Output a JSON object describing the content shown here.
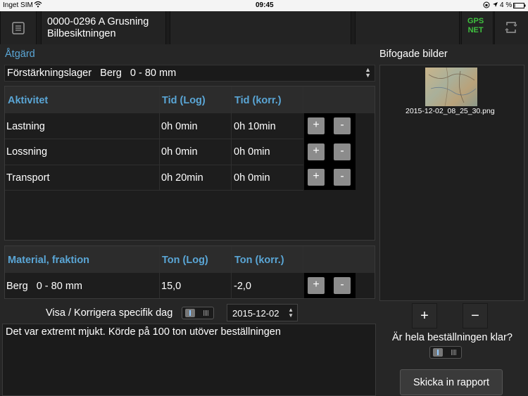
{
  "status_bar": {
    "carrier": "Inget SIM",
    "time": "09:45",
    "battery": "4 %"
  },
  "header": {
    "order_line1": "0000-0296 A Grusning",
    "order_line2": "Bilbesiktningen",
    "gps_line1": "GPS",
    "gps_line2": "NET"
  },
  "atgard": {
    "label": "Åtgärd",
    "selected": "Förstärkningslager   Berg   0 - 80 mm"
  },
  "activity_table": {
    "headers": [
      "Aktivitet",
      "Tid (Log)",
      "Tid (korr.)"
    ],
    "rows": [
      {
        "name": "Lastning",
        "log": "0h 0min",
        "korr": "0h 10min"
      },
      {
        "name": "Lossning",
        "log": "0h 0min",
        "korr": "0h 0min"
      },
      {
        "name": "Transport",
        "log": "0h 20min",
        "korr": "0h 0min"
      }
    ],
    "plus": "+",
    "minus": "-"
  },
  "material_table": {
    "headers": [
      "Material, fraktion",
      "Ton (Log)",
      "Ton (korr.)"
    ],
    "rows": [
      {
        "name": "Berg   0 - 80 mm",
        "log": "15,0",
        "korr": "-2,0"
      }
    ],
    "plus": "+",
    "minus": "-"
  },
  "day": {
    "label": "Visa / Korrigera specifik dag",
    "date": "2015-12-02"
  },
  "comment": "Det var extremt mjukt. Körde på 100 ton utöver beställningen",
  "attachments": {
    "title": "Bifogade bilder",
    "items": [
      {
        "filename": "2015-12-02_08_25_30.png"
      }
    ],
    "add": "+",
    "remove": "−"
  },
  "complete": {
    "question": "Är hela beställningen klar?"
  },
  "submit": {
    "label": "Skicka in rapport"
  }
}
